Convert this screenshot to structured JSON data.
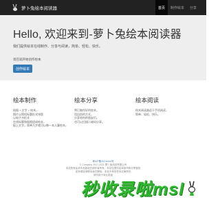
{
  "nav": {
    "brand": "萝卜兔绘本阅读器",
    "items": [
      {
        "label": "首页"
      },
      {
        "label": "制作绘本"
      },
      {
        "label": "分享"
      }
    ]
  },
  "hero": {
    "title": "Hello, 欢迎来到-萝卜兔绘本阅读器",
    "description": "我们提供绘本在线制作、分享与阅读，简单、轻松、快乐。",
    "note": "现在就开始创作绘本",
    "button_label": "创作绘本"
  },
  "features": [
    {
      "title": "绘本制作",
      "lines": [
        "插图 + 文字 = 绘本，",
        "图片以简短标题形式排版",
        "以电子书形式",
        "在线标题和插图组成绘本，",
        "配上文字，简单几步就可以做一本儿童绘本。"
      ]
    },
    {
      "title": "绘本分享",
      "lines": [
        "将已制作好的绘本，",
        "用自由的方式，",
        "分享给你的朋友们。",
        "也可以扫描二维码分享。"
      ]
    },
    {
      "title": "绘本阅读",
      "lines": [
        "绘本阅读器适于手机阅读，",
        "简单、轻松、快乐。"
      ]
    }
  ],
  "footer": {
    "lines": [
      "粤ICP备2021xxxx号",
      "© Company 2017-2021 萝卜兔科技有限公司",
      "本站所有绘本作品版权归原作者所有，本站仅提供绘本制作和分享服务",
      "如有侵权请联系我们删除，本站不承担任何法律责任",
      "请勿用于商业用途"
    ]
  },
  "watermark": {
    "text": "秒收录啦msl"
  },
  "colors": {
    "navbar_bg": "#222222",
    "jumbotron_bg": "#eeeeee",
    "primary": "#337ab7",
    "watermark_green": "#2eb82e"
  }
}
